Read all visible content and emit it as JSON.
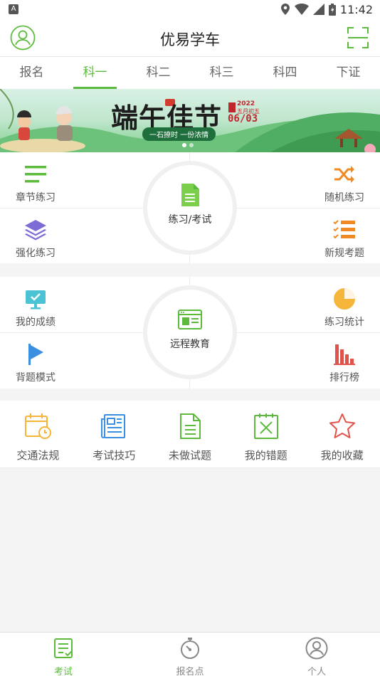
{
  "status_bar": {
    "time": "11:42",
    "left_badge": "A"
  },
  "header": {
    "title": "优易学车"
  },
  "tabs": [
    {
      "label": "报名",
      "active": false
    },
    {
      "label": "科一",
      "active": true
    },
    {
      "label": "科二",
      "active": false
    },
    {
      "label": "科三",
      "active": false
    },
    {
      "label": "科四",
      "active": false
    },
    {
      "label": "下证",
      "active": false
    }
  ],
  "banner": {
    "title": "端午佳节",
    "subtitle": "一石撩时 一份浓情",
    "year": "2022",
    "date": "06/03",
    "lunar": "五月初五",
    "slide_index": 1,
    "slide_count": 2
  },
  "practice_panel": {
    "center_label": "练习/考试",
    "top_left": "章节练习",
    "bottom_left": "强化练习",
    "top_right": "随机练习",
    "bottom_right": "新规考题"
  },
  "remote_panel": {
    "center_label": "远程教育",
    "top_left": "我的成绩",
    "bottom_left": "背题模式",
    "top_right": "练习统计",
    "bottom_right": "排行榜"
  },
  "tools": [
    {
      "label": "交通法规",
      "icon": "calendar-clock-icon"
    },
    {
      "label": "考试技巧",
      "icon": "newspaper-icon"
    },
    {
      "label": "未做试题",
      "icon": "document-icon"
    },
    {
      "label": "我的错题",
      "icon": "wrong-note-icon"
    },
    {
      "label": "我的收藏",
      "icon": "star-icon"
    }
  ],
  "bottom_nav": [
    {
      "label": "考试",
      "active": true
    },
    {
      "label": "报名点",
      "active": false
    },
    {
      "label": "个人",
      "active": false
    }
  ],
  "colors": {
    "accent": "#5cbb3c",
    "orange": "#f08a24",
    "purple": "#7d6bd6",
    "cyan": "#4bc3d4",
    "blue": "#3a8fe0",
    "red": "#e0524a",
    "yellow": "#f5b43a"
  }
}
